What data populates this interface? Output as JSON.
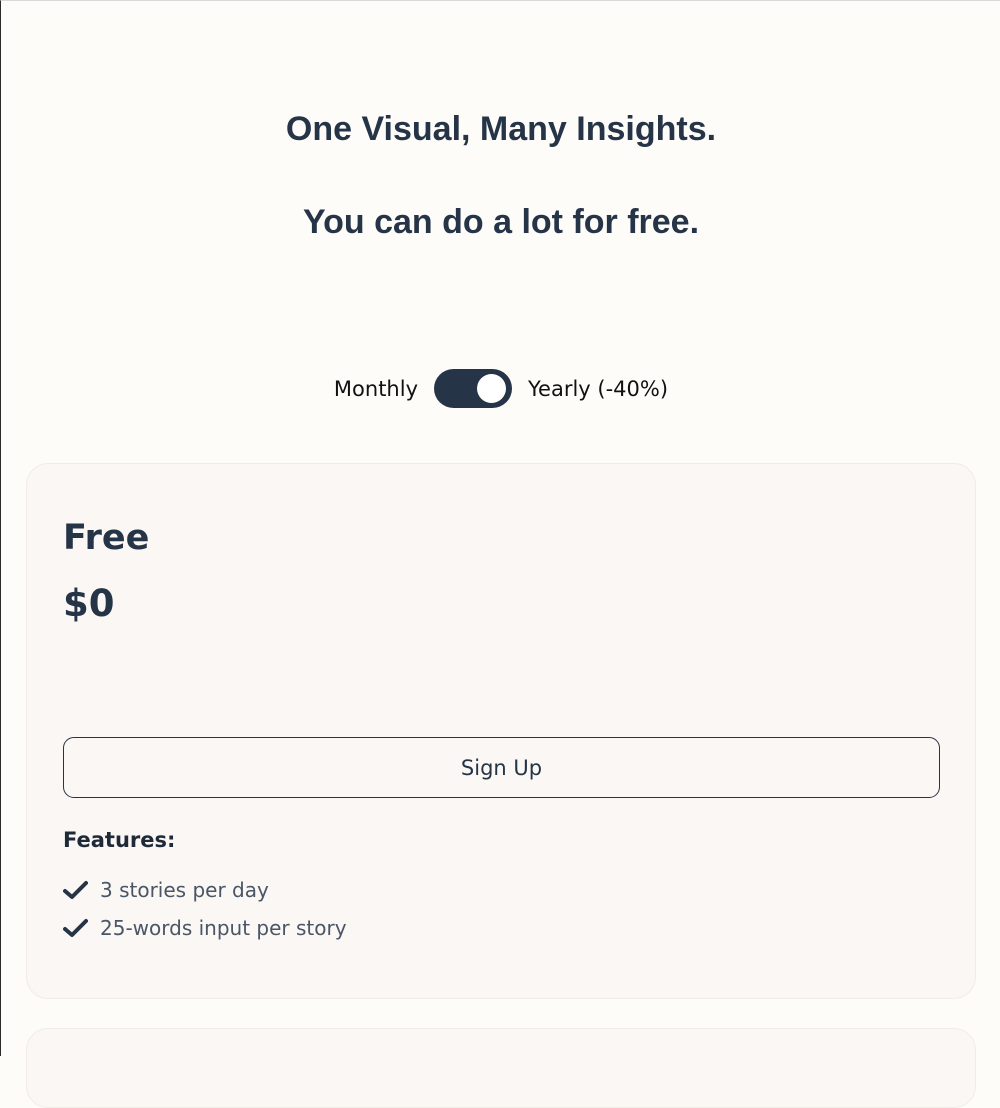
{
  "hero": {
    "title_line1": "One Visual, Many Insights.",
    "title_line2": "You can do a lot for free."
  },
  "billing": {
    "monthly_label": "Monthly",
    "yearly_label": "Yearly (-40%)",
    "toggle_state": "yearly"
  },
  "plan": {
    "name": "Free",
    "price": "$0",
    "cta_label": "Sign Up",
    "features_heading": "Features:",
    "features": [
      {
        "text": "3 stories per day",
        "icon": "check-icon"
      },
      {
        "text": "25-words input per story",
        "icon": "check-icon"
      }
    ]
  },
  "colors": {
    "background": "#fdfcf9",
    "card": "#faf7f4",
    "accent": "#263447",
    "text_muted": "#4a5566"
  }
}
